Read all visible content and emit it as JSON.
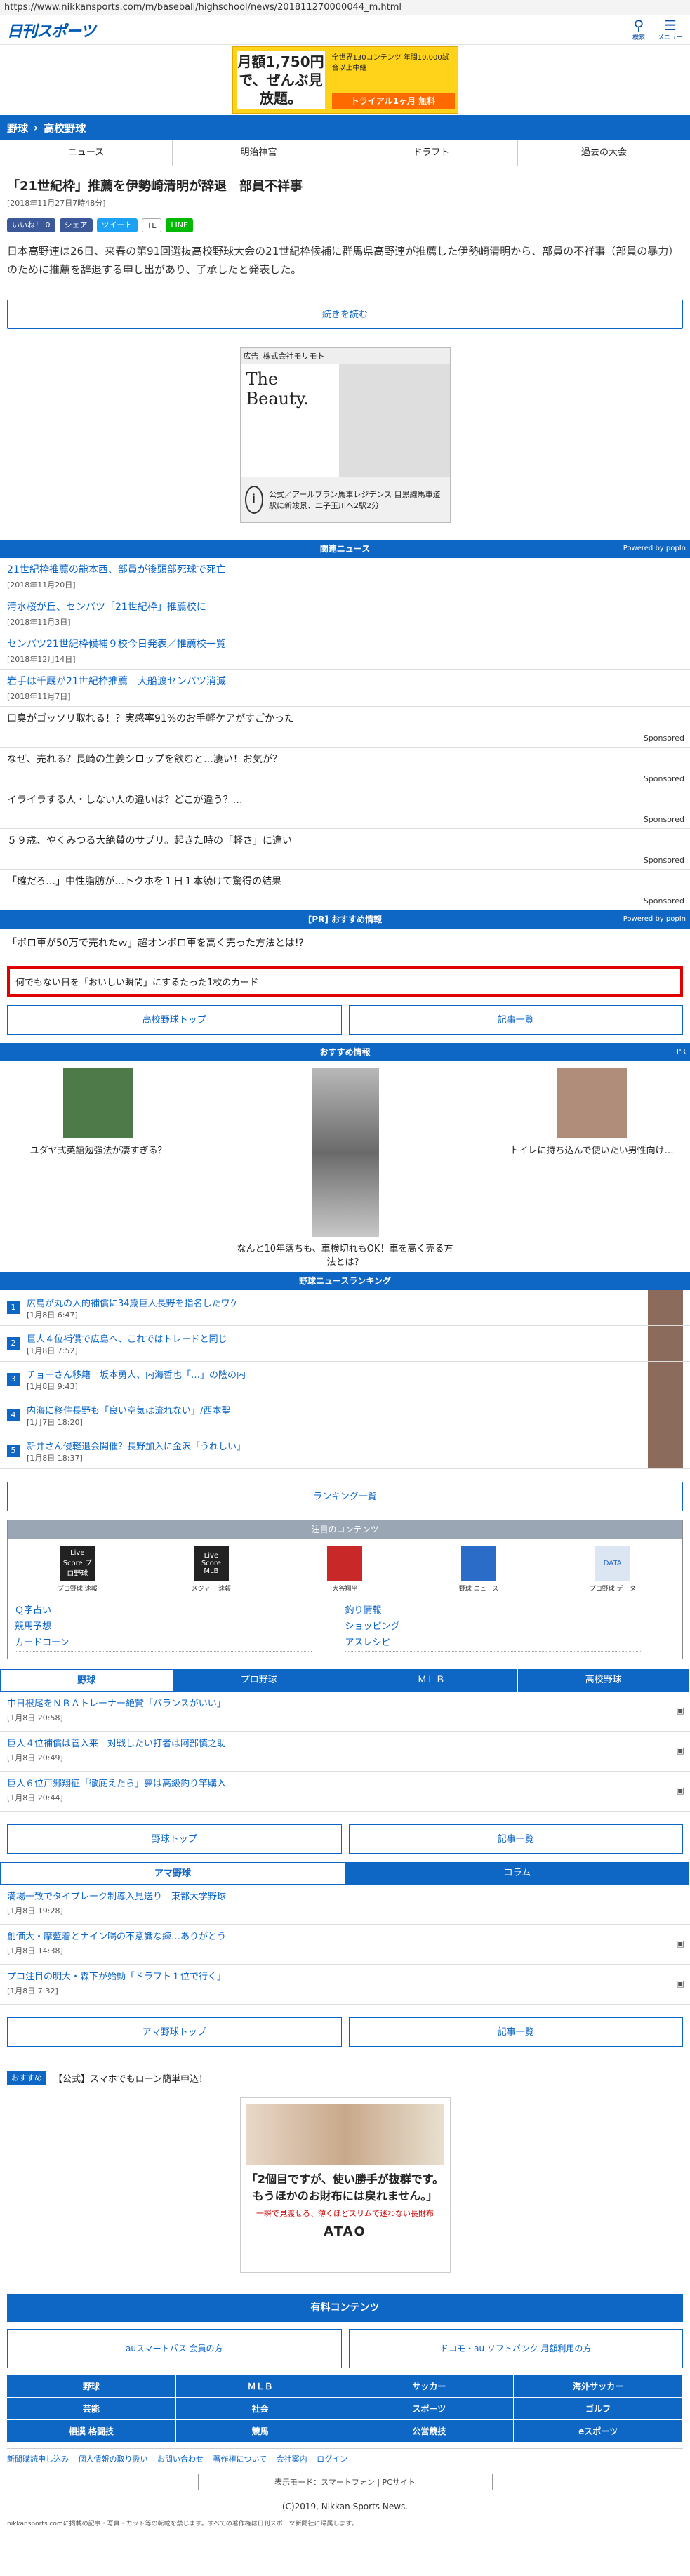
{
  "url": "https://www.nikkansports.com/m/baseball/highschool/news/201811270000044_m.html",
  "header": {
    "logo": "日刊スポーツ",
    "search_label": "検索",
    "menu_label": "メニュー"
  },
  "ad_top": {
    "headline": "月額1,750円で、ぜんぶ見放題。",
    "sub": "全世界130コンテンツ 年間10,000試合以上中継",
    "cta": "トライアル1ヶ月 無料"
  },
  "breadcrumb": [
    "野球",
    "高校野球"
  ],
  "tabs": [
    "ニュース",
    "明治神宮",
    "ドラフト",
    "過去の大会"
  ],
  "article": {
    "title": "「21世紀枠」推薦を伊勢崎清明が辞退　部員不祥事",
    "date": "[2018年11月27日7時48分]",
    "body": "日本高野連は26日、来春の第91回選抜高校野球大会の21世紀枠候補に群馬県高野連が推薦した伊勢崎清明から、部員の不祥事（部員の暴力）のために推薦を辞退する申し出があり、了承したと発表した。",
    "read_more": "続きを読む"
  },
  "social": [
    "いいね！ 0",
    "シェア",
    "ツイート",
    "TL",
    "LINE"
  ],
  "ad_middle": {
    "label": "広告",
    "advertiser": "株式会社モリモト",
    "headline": "The Beauty.",
    "caption": "公式／アールブラン馬車レジデンス 目黒線馬車道駅に新竣景、二子玉川へ2駅2分"
  },
  "related": {
    "heading": "関連ニュース",
    "powered": "Powered by popIn",
    "items": [
      {
        "title": "21世紀枠推薦の能本西、部員が後頭部死球で死亡",
        "date": "[2018年11月20日]"
      },
      {
        "title": "清水桜が丘、センバツ「21世紀枠」推薦校に",
        "date": "[2018年11月3日]"
      },
      {
        "title": "センバツ21世紀枠候補９校今日発表／推薦校一覧",
        "date": "[2018年12月14日]"
      },
      {
        "title": "岩手は千厩が21世紀枠推薦　大船渡センバツ消滅",
        "date": "[2018年11月7日]"
      }
    ],
    "sponsored": [
      {
        "title": "口臭がゴッソリ取れる！？実感率91%のお手軽ケアがすごかった",
        "label": "Sponsored"
      },
      {
        "title": "なぜ、売れる？長崎の生姜シロップを飲むと…凄い！お気が？",
        "label": "Sponsored"
      },
      {
        "title": "イライラする人・しない人の違いは？どこが違う？…",
        "label": "Sponsored"
      },
      {
        "title": "５９歳、やくみつる大絶賛のサプリ。起きた時の「軽さ」に違い",
        "label": "Sponsored"
      },
      {
        "title": "「確だろ…」中性脂肪が…トクホを１日１本続けて驚得の結果",
        "label": "Sponsored"
      }
    ]
  },
  "pr": {
    "heading": "[PR] おすすめ情報",
    "powered": "Powered by popIn",
    "item": "「ボロ車が50万で売れたｗ」超オンボロ車を高く売った方法とは!?"
  },
  "red_box": "何でもない日を「おいしい瞬間」にするたった1枚のカード",
  "nav_buttons_1": [
    "高校野球トップ",
    "記事一覧"
  ],
  "recommend": {
    "heading": "おすすめ情報",
    "pr": "PR",
    "items": [
      "ユダヤ式英語勉強法が凄すぎる？",
      "なんと10年落ちも、車検切れもOK！車を高く売る方法とは？",
      "トイレに持ち込んで使いたい男性向け…"
    ]
  },
  "ranking": {
    "heading": "野球ニュースランキング",
    "items": [
      {
        "title": "広島が丸の人的補償に34歳巨人長野を指名したワケ",
        "date": "[1月8日 6:47]"
      },
      {
        "title": "巨人４位補償で広島へ、これではトレードと同じ",
        "date": "[1月8日 7:52]"
      },
      {
        "title": "チョーさん移籍　坂本勇人、内海哲也「…」の陰の内",
        "date": "[1月8日 9:43]"
      },
      {
        "title": "内海に移住長野も「良い空気は流れない」/西本聖",
        "date": "[1月7日 18:20]"
      },
      {
        "title": "新井さん侵軽退会開催？長野加入に金沢「うれしい」",
        "date": "[1月8日 18:37]"
      }
    ],
    "list_button": "ランキング一覧"
  },
  "attention": {
    "heading": "注目のコンテンツ",
    "icons": [
      {
        "box": "Live Score プロ野球",
        "caption": "プロ野球 速報"
      },
      {
        "box": "Live Score MLB",
        "caption": "メジャー 速報"
      },
      {
        "box": "",
        "caption": "大谷翔平"
      },
      {
        "box": "",
        "caption": "野球 ニュース"
      },
      {
        "box": "DATA",
        "caption": "プロ野球 データ"
      }
    ],
    "links_left": [
      "Ｑ字占い",
      "競馬予想",
      "カードローン"
    ],
    "links_right": [
      "釣り情報",
      "ショッピング",
      "アスレシピ"
    ]
  },
  "sport_tabs": [
    "野球",
    "プロ野球",
    "ＭＬＢ",
    "高校野球"
  ],
  "baseball_news": [
    {
      "title": "中日根尾をＮＢＡトレーナー絶贊「バランスがいい」",
      "date": "[1月8日 20:58]"
    },
    {
      "title": "巨人４位補償は菅入来　対戦したい打者は阿部慎之助",
      "date": "[1月8日 20:49]"
    },
    {
      "title": "巨人６位戸郷翔征「徹底えたら」夢は高級釣り竿購入",
      "date": "[1月8日 20:44]"
    }
  ],
  "nav_buttons_2": [
    "野球トップ",
    "記事一覧"
  ],
  "am_tabs": [
    "アマ野球",
    "コラム"
  ],
  "am_news": [
    {
      "title": "満場一致でタイブレーク制導入見送り　東都大学野球",
      "date": "[1月8日 19:28]"
    },
    {
      "title": "創価大・摩藍着とナイン喝の不意識な練…ありがとう",
      "date": "[1月8日 14:38]"
    },
    {
      "title": "プロ注目の明大・森下が始動「ドラフト１位で行く」",
      "date": "[1月8日 7:32]"
    }
  ],
  "nav_buttons_3": [
    "アマ野球トップ",
    "記事一覧"
  ],
  "bottom_ad_line": {
    "tag": "おすすめ",
    "text": "【公式】スマホでもローン簡単申込！"
  },
  "ad_bottom": {
    "headline": "「2個目ですが、使い勝手が抜群です。もうほかのお財布には戻れません。」",
    "red": "一瞬で見渡せる、薄くほどスリムで迷わない長財布",
    "brand": "ATAO"
  },
  "paid": {
    "heading": "有料コンテンツ",
    "left": "auスマートパス 会員の方",
    "right": "ドコモ・au ソフトバンク 月額利用の方"
  },
  "footer_grid": [
    "野球",
    "ＭＬＢ",
    "サッカー",
    "海外サッカー",
    "芸能",
    "社会",
    "スポーツ",
    "ゴルフ",
    "相撲 格闘技",
    "競馬",
    "公営競技",
    "eスポーツ"
  ],
  "footer_links": [
    "新聞購読申し込み",
    "個人情報の取り扱い",
    "お問い合わせ",
    "著作権について",
    "会社案内",
    "ログイン"
  ],
  "mode": "表示モード：スマートフォン | PCサイト",
  "copyright": "(C)2019, Nikkan Sports News.",
  "note": "nikkansports.comに掲載の記事・写真・カット等の転載を禁じます。すべての著作権は日刊スポーツ新聞社に帰属します。"
}
